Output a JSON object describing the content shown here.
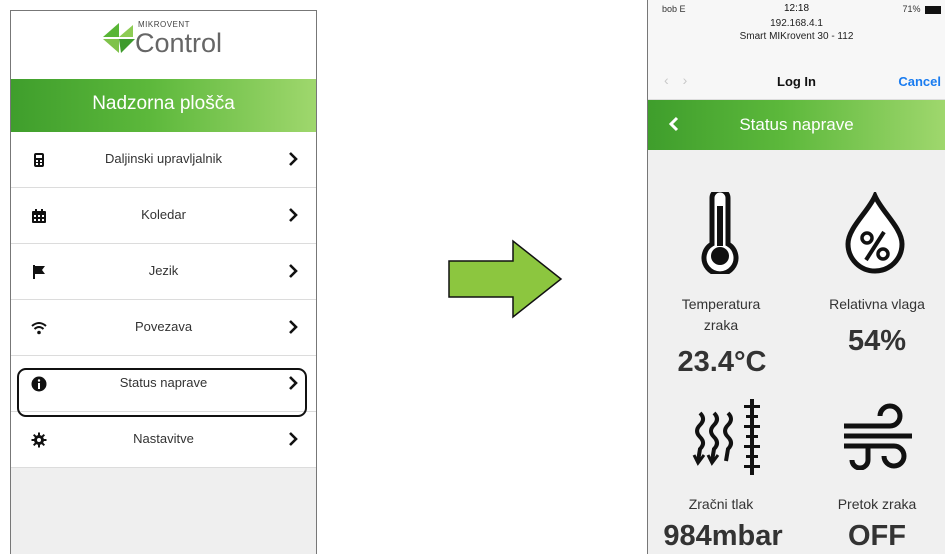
{
  "menu_screen": {
    "logo": {
      "small_text": "MIKROVENT",
      "big_text": "Control"
    },
    "header_title": "Nadzorna plošča",
    "items": [
      {
        "label": "Daljinski upravljalnik",
        "icon": "remote-icon"
      },
      {
        "label": "Koledar",
        "icon": "calendar-icon"
      },
      {
        "label": "Jezik",
        "icon": "flag-icon"
      },
      {
        "label": "Povezava",
        "icon": "wifi-icon"
      },
      {
        "label": "Status naprave",
        "icon": "info-icon",
        "highlighted": true
      },
      {
        "label": "Nastavitve",
        "icon": "gear-icon"
      }
    ]
  },
  "arrow": {
    "color": "#8cc63f"
  },
  "status_screen": {
    "status_bar": {
      "carrier": "bob E",
      "time": "12:18",
      "ip": "192.168.4.1",
      "device": "Smart MIKrovent 30 - 112",
      "battery": "71%"
    },
    "nav": {
      "title": "Log In",
      "cancel_label": "Cancel"
    },
    "header_title": "Status naprave",
    "tiles": [
      {
        "label_line1": "Temperatura",
        "label_line2": "zraka",
        "value": "23.4°C",
        "icon": "thermometer-icon"
      },
      {
        "label_line1": "Relativna vlaga",
        "value": "54%",
        "icon": "humidity-drop-icon"
      },
      {
        "label_line1": "Zračni tlak",
        "value": "984mbar",
        "icon": "pressure-icon"
      },
      {
        "label_line1": "Pretok zraka",
        "value": "OFF",
        "icon": "wind-icon"
      }
    ]
  },
  "colors": {
    "green_dark": "#3f9e2c",
    "green_light": "#9fd76d",
    "ios_blue": "#1a7cf0"
  }
}
